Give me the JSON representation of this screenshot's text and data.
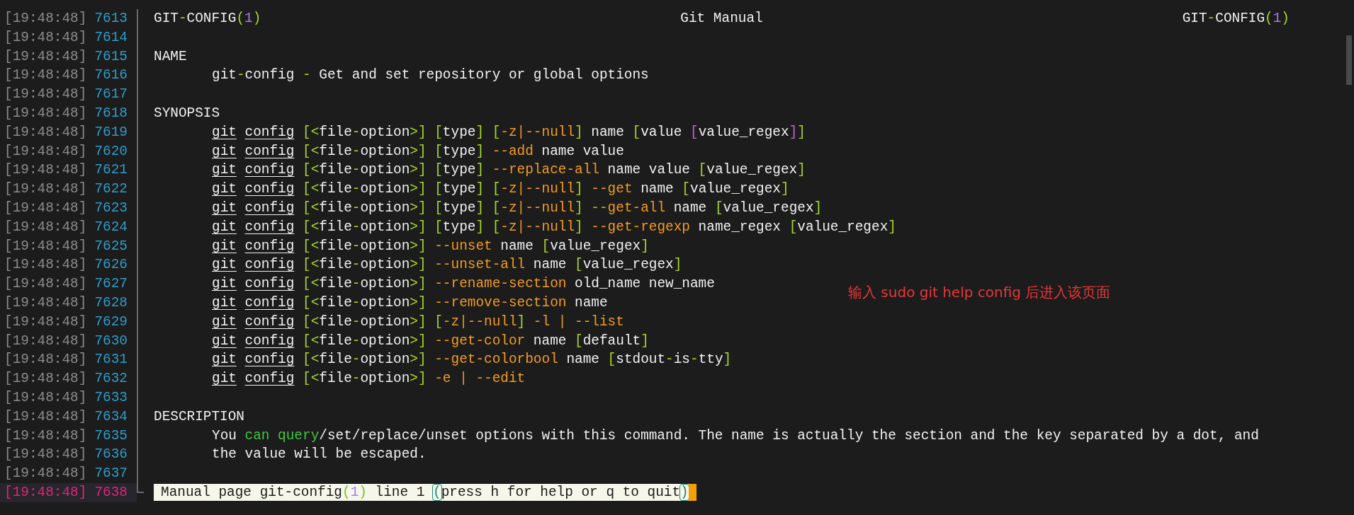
{
  "lines": [
    {
      "time": "[19:48:48]",
      "number": "7613",
      "kind": "header",
      "selected": false,
      "left": [
        {
          "kind": "plain",
          "text": "GIT"
        },
        {
          "kind": "punct",
          "text": "-"
        },
        {
          "kind": "plain",
          "text": "CONFIG"
        },
        {
          "kind": "punct",
          "text": "("
        },
        {
          "kind": "number",
          "text": "1"
        },
        {
          "kind": "punct",
          "text": ")"
        }
      ],
      "center": "Git Manual",
      "right": [
        {
          "kind": "plain",
          "text": "GIT"
        },
        {
          "kind": "punct",
          "text": "-"
        },
        {
          "kind": "plain",
          "text": "CONFIG"
        },
        {
          "kind": "punct",
          "text": "("
        },
        {
          "kind": "number",
          "text": "1"
        },
        {
          "kind": "punct",
          "text": ")"
        }
      ]
    },
    {
      "time": "[19:48:48]",
      "number": "7614",
      "kind": "blank",
      "selected": false
    },
    {
      "time": "[19:48:48]",
      "number": "7615",
      "kind": "heading",
      "selected": false,
      "text": "NAME"
    },
    {
      "time": "[19:48:48]",
      "number": "7616",
      "kind": "body",
      "selected": false,
      "segments": [
        {
          "kind": "plain",
          "text": "git"
        },
        {
          "kind": "punct",
          "text": "-"
        },
        {
          "kind": "plain",
          "text": "config "
        },
        {
          "kind": "punct",
          "text": "-"
        },
        {
          "kind": "plain",
          "text": " Get and set repository or global options"
        }
      ]
    },
    {
      "time": "[19:48:48]",
      "number": "7617",
      "kind": "blank",
      "selected": false
    },
    {
      "time": "[19:48:48]",
      "number": "7618",
      "kind": "heading",
      "selected": false,
      "text": "SYNOPSIS"
    },
    {
      "time": "[19:48:48]",
      "number": "7619",
      "kind": "body",
      "selected": false,
      "segments": [
        {
          "kind": "command",
          "text": "git"
        },
        {
          "kind": "command",
          "text": "config",
          "spaced": true
        },
        {
          "kind": "punct",
          "text": " [<"
        },
        {
          "kind": "plain",
          "text": "file"
        },
        {
          "kind": "punct",
          "text": "-"
        },
        {
          "kind": "plain",
          "text": "option"
        },
        {
          "kind": "punct",
          "text": ">] ["
        },
        {
          "kind": "plain",
          "text": "type"
        },
        {
          "kind": "punct",
          "text": "] ["
        },
        {
          "kind": "option",
          "text": "-z|--null"
        },
        {
          "kind": "punct",
          "text": "]"
        },
        {
          "kind": "plain",
          "text": " name "
        },
        {
          "kind": "punct",
          "text": "["
        },
        {
          "kind": "plain",
          "text": "value "
        },
        {
          "kind": "nested",
          "text": "["
        },
        {
          "kind": "plain",
          "text": "value_regex"
        },
        {
          "kind": "nested",
          "text": "]"
        },
        {
          "kind": "punct",
          "text": "]"
        }
      ]
    },
    {
      "time": "[19:48:48]",
      "number": "7620",
      "kind": "body",
      "selected": false,
      "segments": [
        {
          "kind": "command",
          "text": "git"
        },
        {
          "kind": "command",
          "text": "config",
          "spaced": true
        },
        {
          "kind": "punct",
          "text": " [<"
        },
        {
          "kind": "plain",
          "text": "file"
        },
        {
          "kind": "punct",
          "text": "-"
        },
        {
          "kind": "plain",
          "text": "option"
        },
        {
          "kind": "punct",
          "text": ">] ["
        },
        {
          "kind": "plain",
          "text": "type"
        },
        {
          "kind": "punct",
          "text": "]"
        },
        {
          "kind": "option",
          "text": " --add"
        },
        {
          "kind": "plain",
          "text": " name value"
        }
      ]
    },
    {
      "time": "[19:48:48]",
      "number": "7621",
      "kind": "body",
      "selected": false,
      "segments": [
        {
          "kind": "command",
          "text": "git"
        },
        {
          "kind": "command",
          "text": "config",
          "spaced": true
        },
        {
          "kind": "punct",
          "text": " [<"
        },
        {
          "kind": "plain",
          "text": "file"
        },
        {
          "kind": "punct",
          "text": "-"
        },
        {
          "kind": "plain",
          "text": "option"
        },
        {
          "kind": "punct",
          "text": ">] ["
        },
        {
          "kind": "plain",
          "text": "type"
        },
        {
          "kind": "punct",
          "text": "]"
        },
        {
          "kind": "option",
          "text": " --replace-all"
        },
        {
          "kind": "plain",
          "text": " name value "
        },
        {
          "kind": "punct",
          "text": "["
        },
        {
          "kind": "plain",
          "text": "value_regex"
        },
        {
          "kind": "punct",
          "text": "]"
        }
      ]
    },
    {
      "time": "[19:48:48]",
      "number": "7622",
      "kind": "body",
      "selected": false,
      "segments": [
        {
          "kind": "command",
          "text": "git"
        },
        {
          "kind": "command",
          "text": "config",
          "spaced": true
        },
        {
          "kind": "punct",
          "text": " [<"
        },
        {
          "kind": "plain",
          "text": "file"
        },
        {
          "kind": "punct",
          "text": "-"
        },
        {
          "kind": "plain",
          "text": "option"
        },
        {
          "kind": "punct",
          "text": ">] ["
        },
        {
          "kind": "plain",
          "text": "type"
        },
        {
          "kind": "punct",
          "text": "] ["
        },
        {
          "kind": "option",
          "text": "-z|--null"
        },
        {
          "kind": "punct",
          "text": "]"
        },
        {
          "kind": "option",
          "text": " --get"
        },
        {
          "kind": "plain",
          "text": " name "
        },
        {
          "kind": "punct",
          "text": "["
        },
        {
          "kind": "plain",
          "text": "value_regex"
        },
        {
          "kind": "punct",
          "text": "]"
        }
      ]
    },
    {
      "time": "[19:48:48]",
      "number": "7623",
      "kind": "body",
      "selected": false,
      "segments": [
        {
          "kind": "command",
          "text": "git"
        },
        {
          "kind": "command",
          "text": "config",
          "spaced": true
        },
        {
          "kind": "punct",
          "text": " [<"
        },
        {
          "kind": "plain",
          "text": "file"
        },
        {
          "kind": "punct",
          "text": "-"
        },
        {
          "kind": "plain",
          "text": "option"
        },
        {
          "kind": "punct",
          "text": ">] ["
        },
        {
          "kind": "plain",
          "text": "type"
        },
        {
          "kind": "punct",
          "text": "] ["
        },
        {
          "kind": "option",
          "text": "-z|--null"
        },
        {
          "kind": "punct",
          "text": "]"
        },
        {
          "kind": "option",
          "text": " --get-all"
        },
        {
          "kind": "plain",
          "text": " name "
        },
        {
          "kind": "punct",
          "text": "["
        },
        {
          "kind": "plain",
          "text": "value_regex"
        },
        {
          "kind": "punct",
          "text": "]"
        }
      ]
    },
    {
      "time": "[19:48:48]",
      "number": "7624",
      "kind": "body",
      "selected": false,
      "segments": [
        {
          "kind": "command",
          "text": "git"
        },
        {
          "kind": "command",
          "text": "config",
          "spaced": true
        },
        {
          "kind": "punct",
          "text": " [<"
        },
        {
          "kind": "plain",
          "text": "file"
        },
        {
          "kind": "punct",
          "text": "-"
        },
        {
          "kind": "plain",
          "text": "option"
        },
        {
          "kind": "punct",
          "text": ">] ["
        },
        {
          "kind": "plain",
          "text": "type"
        },
        {
          "kind": "punct",
          "text": "] ["
        },
        {
          "kind": "option",
          "text": "-z|--null"
        },
        {
          "kind": "punct",
          "text": "]"
        },
        {
          "kind": "option",
          "text": " --get-regexp"
        },
        {
          "kind": "plain",
          "text": " name_regex "
        },
        {
          "kind": "punct",
          "text": "["
        },
        {
          "kind": "plain",
          "text": "value_regex"
        },
        {
          "kind": "punct",
          "text": "]"
        }
      ]
    },
    {
      "time": "[19:48:48]",
      "number": "7625",
      "kind": "body",
      "selected": false,
      "segments": [
        {
          "kind": "command",
          "text": "git"
        },
        {
          "kind": "command",
          "text": "config",
          "spaced": true
        },
        {
          "kind": "punct",
          "text": " [<"
        },
        {
          "kind": "plain",
          "text": "file"
        },
        {
          "kind": "punct",
          "text": "-"
        },
        {
          "kind": "plain",
          "text": "option"
        },
        {
          "kind": "punct",
          "text": ">]"
        },
        {
          "kind": "option",
          "text": " --unset"
        },
        {
          "kind": "plain",
          "text": " name "
        },
        {
          "kind": "punct",
          "text": "["
        },
        {
          "kind": "plain",
          "text": "value_regex"
        },
        {
          "kind": "punct",
          "text": "]"
        }
      ]
    },
    {
      "time": "[19:48:48]",
      "number": "7626",
      "kind": "body",
      "selected": false,
      "segments": [
        {
          "kind": "command",
          "text": "git"
        },
        {
          "kind": "command",
          "text": "config",
          "spaced": true
        },
        {
          "kind": "punct",
          "text": " [<"
        },
        {
          "kind": "plain",
          "text": "file"
        },
        {
          "kind": "punct",
          "text": "-"
        },
        {
          "kind": "plain",
          "text": "option"
        },
        {
          "kind": "punct",
          "text": ">]"
        },
        {
          "kind": "option",
          "text": " --unset-all"
        },
        {
          "kind": "plain",
          "text": " name "
        },
        {
          "kind": "punct",
          "text": "["
        },
        {
          "kind": "plain",
          "text": "value_regex"
        },
        {
          "kind": "punct",
          "text": "]"
        }
      ]
    },
    {
      "time": "[19:48:48]",
      "number": "7627",
      "kind": "body",
      "selected": false,
      "segments": [
        {
          "kind": "command",
          "text": "git"
        },
        {
          "kind": "command",
          "text": "config",
          "spaced": true
        },
        {
          "kind": "punct",
          "text": " [<"
        },
        {
          "kind": "plain",
          "text": "file"
        },
        {
          "kind": "punct",
          "text": "-"
        },
        {
          "kind": "plain",
          "text": "option"
        },
        {
          "kind": "punct",
          "text": ">]"
        },
        {
          "kind": "option",
          "text": " --rename-section"
        },
        {
          "kind": "plain",
          "text": " old_name new_name"
        }
      ]
    },
    {
      "time": "[19:48:48]",
      "number": "7628",
      "kind": "body",
      "selected": false,
      "segments": [
        {
          "kind": "command",
          "text": "git"
        },
        {
          "kind": "command",
          "text": "config",
          "spaced": true
        },
        {
          "kind": "punct",
          "text": " [<"
        },
        {
          "kind": "plain",
          "text": "file"
        },
        {
          "kind": "punct",
          "text": "-"
        },
        {
          "kind": "plain",
          "text": "option"
        },
        {
          "kind": "punct",
          "text": ">]"
        },
        {
          "kind": "option",
          "text": " --remove-section"
        },
        {
          "kind": "plain",
          "text": " name"
        }
      ]
    },
    {
      "time": "[19:48:48]",
      "number": "7629",
      "kind": "body",
      "selected": false,
      "segments": [
        {
          "kind": "command",
          "text": "git"
        },
        {
          "kind": "command",
          "text": "config",
          "spaced": true
        },
        {
          "kind": "punct",
          "text": " [<"
        },
        {
          "kind": "plain",
          "text": "file"
        },
        {
          "kind": "punct",
          "text": "-"
        },
        {
          "kind": "plain",
          "text": "option"
        },
        {
          "kind": "punct",
          "text": ">] ["
        },
        {
          "kind": "option",
          "text": "-z|--null"
        },
        {
          "kind": "punct",
          "text": "]"
        },
        {
          "kind": "option",
          "text": " -l | --list"
        }
      ]
    },
    {
      "time": "[19:48:48]",
      "number": "7630",
      "kind": "body",
      "selected": false,
      "segments": [
        {
          "kind": "command",
          "text": "git"
        },
        {
          "kind": "command",
          "text": "config",
          "spaced": true
        },
        {
          "kind": "punct",
          "text": " [<"
        },
        {
          "kind": "plain",
          "text": "file"
        },
        {
          "kind": "punct",
          "text": "-"
        },
        {
          "kind": "plain",
          "text": "option"
        },
        {
          "kind": "punct",
          "text": ">]"
        },
        {
          "kind": "option",
          "text": " --get-color"
        },
        {
          "kind": "plain",
          "text": " name "
        },
        {
          "kind": "punct",
          "text": "["
        },
        {
          "kind": "plain",
          "text": "default"
        },
        {
          "kind": "punct",
          "text": "]"
        }
      ]
    },
    {
      "time": "[19:48:48]",
      "number": "7631",
      "kind": "body",
      "selected": false,
      "segments": [
        {
          "kind": "command",
          "text": "git"
        },
        {
          "kind": "command",
          "text": "config",
          "spaced": true
        },
        {
          "kind": "punct",
          "text": " [<"
        },
        {
          "kind": "plain",
          "text": "file"
        },
        {
          "kind": "punct",
          "text": "-"
        },
        {
          "kind": "plain",
          "text": "option"
        },
        {
          "kind": "punct",
          "text": ">]"
        },
        {
          "kind": "option",
          "text": " --get-colorbool"
        },
        {
          "kind": "plain",
          "text": " name "
        },
        {
          "kind": "punct",
          "text": "["
        },
        {
          "kind": "plain",
          "text": "stdout"
        },
        {
          "kind": "punct",
          "text": "-"
        },
        {
          "kind": "plain",
          "text": "is"
        },
        {
          "kind": "punct",
          "text": "-"
        },
        {
          "kind": "plain",
          "text": "tty"
        },
        {
          "kind": "punct",
          "text": "]"
        }
      ]
    },
    {
      "time": "[19:48:48]",
      "number": "7632",
      "kind": "body",
      "selected": false,
      "segments": [
        {
          "kind": "command",
          "text": "git"
        },
        {
          "kind": "command",
          "text": "config",
          "spaced": true
        },
        {
          "kind": "punct",
          "text": " [<"
        },
        {
          "kind": "plain",
          "text": "file"
        },
        {
          "kind": "punct",
          "text": "-"
        },
        {
          "kind": "plain",
          "text": "option"
        },
        {
          "kind": "punct",
          "text": ">]"
        },
        {
          "kind": "option",
          "text": " -e | --edit"
        }
      ]
    },
    {
      "time": "[19:48:48]",
      "number": "7633",
      "kind": "blank",
      "selected": false
    },
    {
      "time": "[19:48:48]",
      "number": "7634",
      "kind": "heading",
      "selected": false,
      "text": "DESCRIPTION"
    },
    {
      "time": "[19:48:48]",
      "number": "7635",
      "kind": "body",
      "selected": false,
      "segments": [
        {
          "kind": "plain",
          "text": "You "
        },
        {
          "kind": "keyword",
          "text": "can query"
        },
        {
          "kind": "plain",
          "text": "/set/replace/unset options with this command. The name is actually the section and the key separated by a dot, and"
        }
      ]
    },
    {
      "time": "[19:48:48]",
      "number": "7636",
      "kind": "body",
      "selected": false,
      "segments": [
        {
          "kind": "plain",
          "text": "the value will be escaped."
        }
      ]
    },
    {
      "time": "[19:48:48]",
      "number": "7637",
      "kind": "blank",
      "selected": false
    },
    {
      "time": "[19:48:48]",
      "number": "7638",
      "kind": "status",
      "selected": true,
      "cursor": true,
      "segments": [
        {
          "kind": "plain",
          "text": "Manual page git-config"
        },
        {
          "kind": "punct",
          "text": "("
        },
        {
          "kind": "number",
          "text": "1"
        },
        {
          "kind": "punct",
          "text": ")"
        },
        {
          "kind": "plain",
          "text": " line 1 "
        },
        {
          "kind": "paren",
          "text": "("
        },
        {
          "kind": "plain",
          "text": "press h for help or q to quit"
        },
        {
          "kind": "paren",
          "text": ")"
        }
      ]
    }
  ],
  "annotation": "输入 sudo git help config 后进入该页面"
}
